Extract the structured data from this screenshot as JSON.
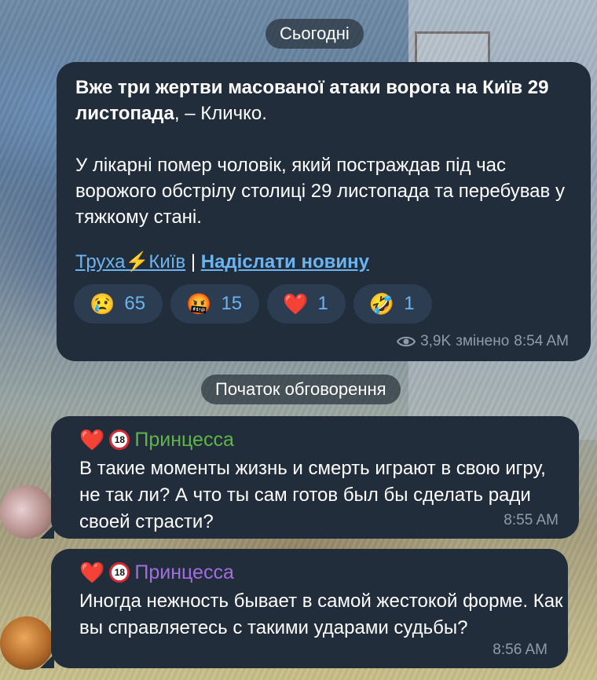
{
  "date_separator": "Сьогодні",
  "post": {
    "title_bold": "Вже три жертви масованої атаки ворога на Київ 29 листопада",
    "title_rest": ", – Кличко.",
    "body": "У лікарні помер чоловік, який постраждав під час ворожого обстрілу столиці 29 листопада та перебував у тяжкому стані.",
    "channel_link_a": "Труха",
    "channel_link_b": "Київ",
    "separator": "|",
    "send_news_link": "Надіслати новину",
    "reactions": [
      {
        "emoji": "😢",
        "count": "65"
      },
      {
        "emoji": "🤬",
        "count": "15"
      },
      {
        "emoji": "❤️",
        "count": "1"
      },
      {
        "emoji": "🤣",
        "count": "1"
      }
    ],
    "views": "3,9K",
    "edited": "змінено",
    "time": "8:54 AM"
  },
  "discussion_separator": "Початок обговорення",
  "messages": [
    {
      "author": "Принцесса",
      "author_color": "#5fb548",
      "text": "В такие моменты жизнь и смерть играют в свою игру, не так ли? А что ты сам готов был бы сделать ради своей страсти?",
      "time": "8:55 AM"
    },
    {
      "author": "Принцесса",
      "author_color": "#a36de0",
      "text": "Иногда нежность бывает в самой жестокой форме. Как вы справляетесь с такими ударами судьбы?",
      "time": "8:56 AM"
    }
  ],
  "colors": {
    "bubble": "#212d3b",
    "link": "#6cb4f0",
    "meta": "#8f9daa"
  }
}
